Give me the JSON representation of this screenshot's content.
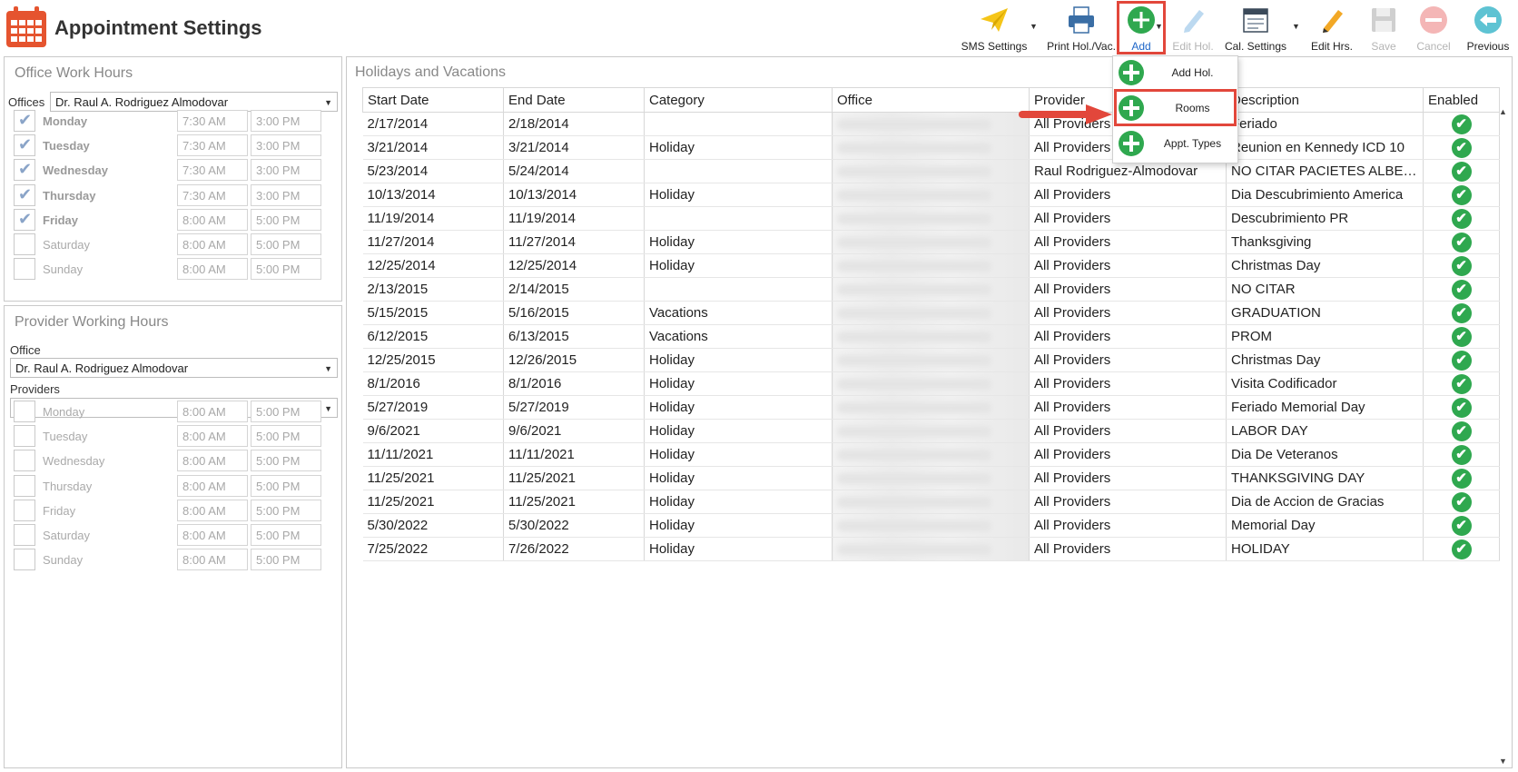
{
  "app": {
    "title": "Appointment Settings"
  },
  "toolbar": {
    "sms": "SMS Settings",
    "print": "Print Hol./Vac.",
    "add": "Add",
    "edit_hol": "Edit Hol.",
    "cal_settings": "Cal. Settings",
    "edit_hrs": "Edit Hrs.",
    "save": "Save",
    "cancel": "Cancel",
    "previous": "Previous"
  },
  "add_menu": {
    "items": [
      {
        "label": "Add Hol."
      },
      {
        "label": "Rooms"
      },
      {
        "label": "Appt. Types"
      }
    ]
  },
  "office_hours": {
    "title": "Office Work Hours",
    "offices_label": "Offices",
    "office_value": "Dr. Raul A. Rodriguez Almodovar",
    "days": [
      {
        "day": "Monday",
        "checked": true,
        "start": "7:30 AM",
        "end": "3:00 PM"
      },
      {
        "day": "Tuesday",
        "checked": true,
        "start": "7:30 AM",
        "end": "3:00 PM"
      },
      {
        "day": "Wednesday",
        "checked": true,
        "start": "7:30 AM",
        "end": "3:00 PM"
      },
      {
        "day": "Thursday",
        "checked": true,
        "start": "7:30 AM",
        "end": "3:00 PM"
      },
      {
        "day": "Friday",
        "checked": true,
        "start": "8:00 AM",
        "end": "5:00 PM"
      },
      {
        "day": "Saturday",
        "checked": false,
        "start": "8:00 AM",
        "end": "5:00 PM"
      },
      {
        "day": "Sunday",
        "checked": false,
        "start": "8:00 AM",
        "end": "5:00 PM"
      }
    ]
  },
  "provider_hours": {
    "title": "Provider Working Hours",
    "office_label": "Office",
    "office_value": "Dr. Raul A. Rodriguez Almodovar",
    "providers_label": "Providers",
    "providers_value": "",
    "days": [
      {
        "day": "Monday",
        "checked": false,
        "start": "8:00 AM",
        "end": "5:00 PM"
      },
      {
        "day": "Tuesday",
        "checked": false,
        "start": "8:00 AM",
        "end": "5:00 PM"
      },
      {
        "day": "Wednesday",
        "checked": false,
        "start": "8:00 AM",
        "end": "5:00 PM"
      },
      {
        "day": "Thursday",
        "checked": false,
        "start": "8:00 AM",
        "end": "5:00 PM"
      },
      {
        "day": "Friday",
        "checked": false,
        "start": "8:00 AM",
        "end": "5:00 PM"
      },
      {
        "day": "Saturday",
        "checked": false,
        "start": "8:00 AM",
        "end": "5:00 PM"
      },
      {
        "day": "Sunday",
        "checked": false,
        "start": "8:00 AM",
        "end": "5:00 PM"
      }
    ]
  },
  "holidays": {
    "title": "Holidays and Vacations",
    "columns": [
      "Start Date",
      "End Date",
      "Category",
      "Office",
      "Provider",
      "Description",
      "Enabled"
    ],
    "rows": [
      {
        "start": "2/17/2014",
        "end": "2/18/2014",
        "category": "",
        "provider": "All Providers",
        "description": "Feriado",
        "enabled": true
      },
      {
        "start": "3/21/2014",
        "end": "3/21/2014",
        "category": "Holiday",
        "provider": "All Providers",
        "description": "Reunion en Kennedy ICD 10",
        "enabled": true
      },
      {
        "start": "5/23/2014",
        "end": "5/24/2014",
        "category": "",
        "provider": "Raul Rodriguez-Almodovar",
        "description": "NO CITAR PACIETES ALBERTO",
        "enabled": true
      },
      {
        "start": "10/13/2014",
        "end": "10/13/2014",
        "category": "Holiday",
        "provider": "All Providers",
        "description": "Dia Descubrimiento America",
        "enabled": true
      },
      {
        "start": "11/19/2014",
        "end": "11/19/2014",
        "category": "",
        "provider": "All Providers",
        "description": "Descubrimiento PR",
        "enabled": true
      },
      {
        "start": "11/27/2014",
        "end": "11/27/2014",
        "category": "Holiday",
        "provider": "All Providers",
        "description": "Thanksgiving",
        "enabled": true
      },
      {
        "start": "12/25/2014",
        "end": "12/25/2014",
        "category": "Holiday",
        "provider": "All Providers",
        "description": "Christmas Day",
        "enabled": true
      },
      {
        "start": "2/13/2015",
        "end": "2/14/2015",
        "category": "",
        "provider": "All Providers",
        "description": "NO CITAR",
        "enabled": true
      },
      {
        "start": "5/15/2015",
        "end": "5/16/2015",
        "category": "Vacations",
        "provider": "All Providers",
        "description": "GRADUATION",
        "enabled": true
      },
      {
        "start": "6/12/2015",
        "end": "6/13/2015",
        "category": "Vacations",
        "provider": "All Providers",
        "description": "PROM",
        "enabled": true
      },
      {
        "start": "12/25/2015",
        "end": "12/26/2015",
        "category": "Holiday",
        "provider": "All Providers",
        "description": "Christmas Day",
        "enabled": true
      },
      {
        "start": "8/1/2016",
        "end": "8/1/2016",
        "category": "Holiday",
        "provider": "All Providers",
        "description": "Visita Codificador",
        "enabled": true
      },
      {
        "start": "5/27/2019",
        "end": "5/27/2019",
        "category": "Holiday",
        "provider": "All Providers",
        "description": "Feriado Memorial Day",
        "enabled": true
      },
      {
        "start": "9/6/2021",
        "end": "9/6/2021",
        "category": "Holiday",
        "provider": "All Providers",
        "description": "LABOR DAY",
        "enabled": true
      },
      {
        "start": "11/11/2021",
        "end": "11/11/2021",
        "category": "Holiday",
        "provider": "All Providers",
        "description": "Dia De Veteranos",
        "enabled": true
      },
      {
        "start": "11/25/2021",
        "end": "11/25/2021",
        "category": "Holiday",
        "provider": "All Providers",
        "description": "THANKSGIVING DAY",
        "enabled": true
      },
      {
        "start": "11/25/2021",
        "end": "11/25/2021",
        "category": "Holiday",
        "provider": "All Providers",
        "description": "Dia de Accion de Gracias",
        "enabled": true
      },
      {
        "start": "5/30/2022",
        "end": "5/30/2022",
        "category": "Holiday",
        "provider": "All Providers",
        "description": "Memorial Day",
        "enabled": true
      },
      {
        "start": "7/25/2022",
        "end": "7/26/2022",
        "category": "Holiday",
        "provider": "All Providers",
        "description": "HOLIDAY",
        "enabled": true
      }
    ]
  },
  "colors": {
    "accent_red": "#e2473b",
    "add_green": "#2fa84f",
    "active_blue": "#1e66c8"
  }
}
